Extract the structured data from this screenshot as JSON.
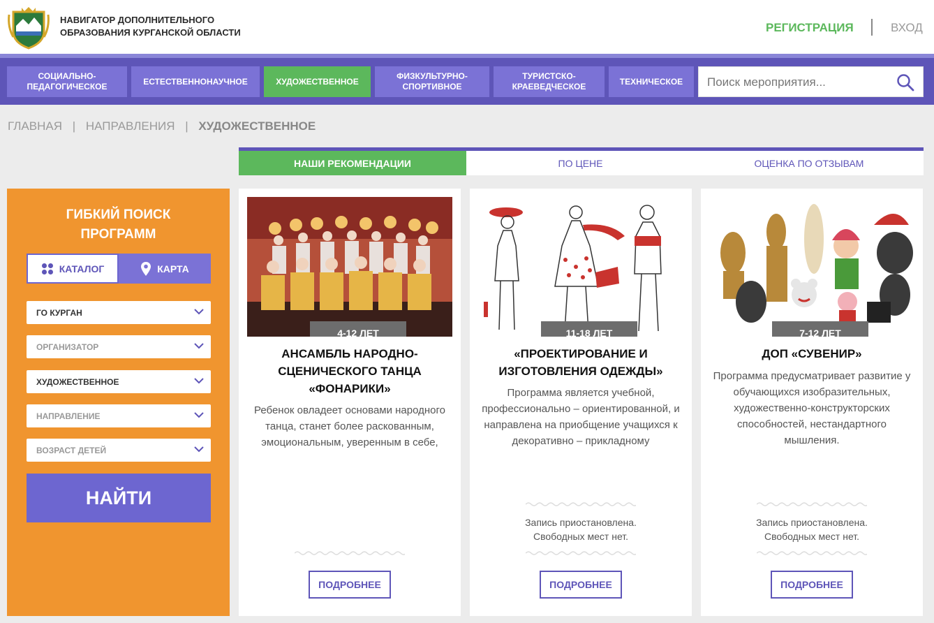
{
  "header": {
    "site_title_line1": "НАВИГАТОР ДОПОЛНИТЕЛЬНОГО",
    "site_title_line2": "ОБРАЗОВАНИЯ КУРГАНСКОЙ ОБЛАСТИ",
    "register_label": "РЕГИСТРАЦИЯ",
    "login_label": "ВХОД"
  },
  "nav": {
    "items": [
      {
        "line1": "Социально-",
        "line2": "педагогическое"
      },
      {
        "line1": "Естественнонаучное",
        "line2": ""
      },
      {
        "line1": "Художественное",
        "line2": ""
      },
      {
        "line1": "Физкультурно-",
        "line2": "спортивное"
      },
      {
        "line1": "Туристско-",
        "line2": "краеведческое"
      },
      {
        "line1": "Техническое",
        "line2": ""
      }
    ],
    "active_index": 2
  },
  "search": {
    "placeholder": "Поиск мероприятия..."
  },
  "breadcrumb": {
    "home": "ГЛАВНАЯ",
    "section": "НАПРАВЛЕНИЯ",
    "current": "ХУДОЖЕСТВЕННОЕ",
    "separator": "|"
  },
  "sort_tabs": [
    "НАШИ РЕКОМЕНДАЦИИ",
    "ПО ЦЕНЕ",
    "ОЦЕНКА ПО ОТЗЫВАМ"
  ],
  "sidebar": {
    "title_line1": "ГИБКИЙ ПОИСК",
    "title_line2": "ПРОГРАММ",
    "catalog_label": "КАТАЛОГ",
    "map_label": "КАРТА",
    "filters": [
      {
        "value": "ГО КУРГАН",
        "filled": true
      },
      {
        "value": "ОРГАНИЗАТОР",
        "filled": false
      },
      {
        "value": "ХУДОЖЕСТВЕННОЕ",
        "filled": true
      },
      {
        "value": "НАПРАВЛЕНИЕ",
        "filled": false
      },
      {
        "value": "ВОЗРАСТ ДЕТЕЙ",
        "filled": false
      }
    ],
    "find_label": "НАЙТИ"
  },
  "cards": [
    {
      "age": "4-12 ЛЕТ",
      "title": "Ансамбль народно-сценического танца «Фонарики»",
      "description": "Ребенок овладеет основами народного танца, станет более раскованным, эмоциональным, уверенным в себе,",
      "status_line1": "",
      "status_line2": "",
      "more_label": "ПОДРОБНЕЕ"
    },
    {
      "age": "11-18 ЛЕТ",
      "title": "«Проектирование и изготовления одежды»",
      "description": "Программа является учебной, профессионально – ориентированной, и направлена на приобщение учащихся к декоративно – прикладному",
      "status_line1": "Запись приостановлена.",
      "status_line2": "Свободных мест нет.",
      "more_label": "ПОДРОБНЕЕ"
    },
    {
      "age": "7-12 ЛЕТ",
      "title": "ДОП «Сувенир»",
      "description": "Программа предусматривает развитие у обучающихся изобразительных, художественно-конструкторских способностей, нестандартного мышления.",
      "status_line1": "Запись приостановлена.",
      "status_line2": "Свободных мест нет.",
      "more_label": "ПОДРОБНЕЕ"
    }
  ],
  "colors": {
    "purple": "#5e55b8",
    "purple_light": "#7b72d6",
    "green": "#5cb85c",
    "orange": "#f0952f"
  }
}
